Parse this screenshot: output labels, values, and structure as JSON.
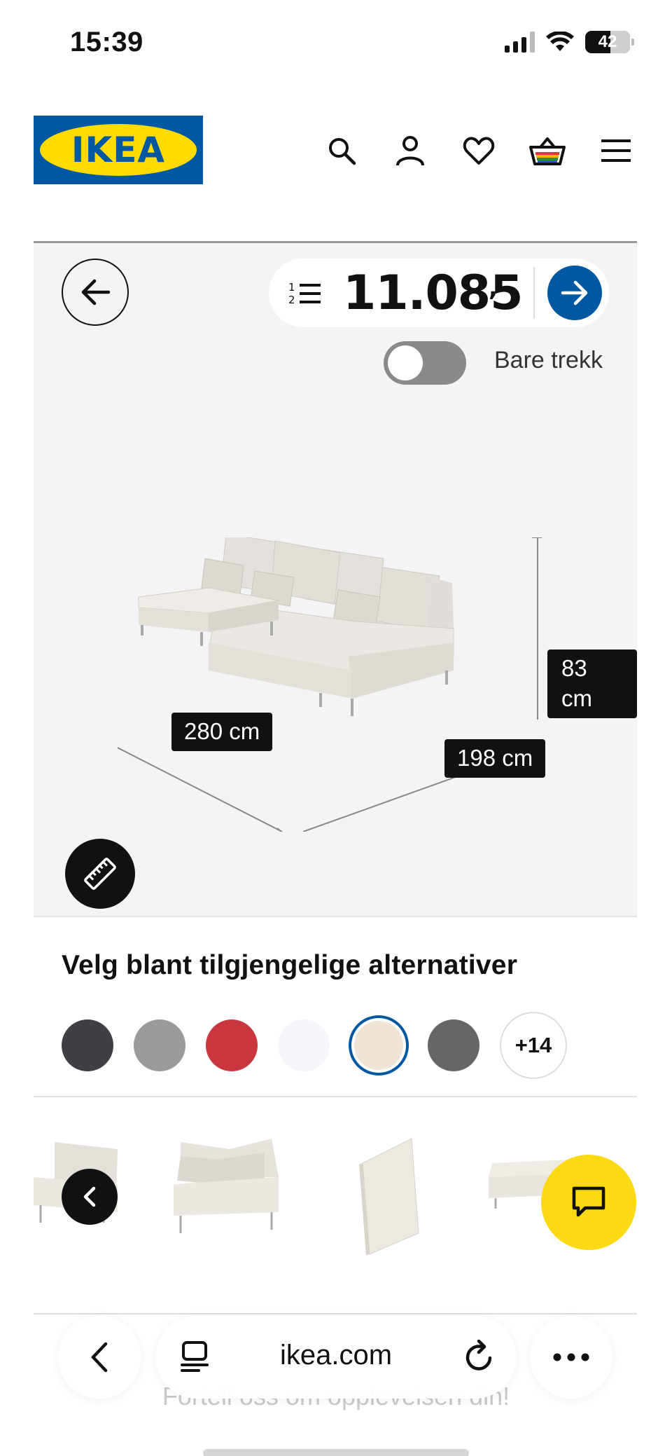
{
  "status_bar": {
    "time": "15:39",
    "battery": "42",
    "icons": [
      "signal-icon",
      "wifi-icon",
      "battery-icon"
    ]
  },
  "header": {
    "logo_text": "IKEA",
    "icons": [
      "search-icon",
      "account-icon",
      "heart-icon",
      "basket-icon",
      "menu-icon"
    ]
  },
  "viewer": {
    "price": "11.085",
    "price_suffix": ",-",
    "toggle_label": "Bare trekk",
    "toggle_on": false,
    "dimensions": {
      "width": "280 cm",
      "depth": "198 cm",
      "height_line1": "83",
      "height_line2": "cm"
    }
  },
  "alternatives": {
    "title": "Velg blant tilgjengelige alternativer",
    "swatches": [
      {
        "color": "#3f3f44",
        "selected": false
      },
      {
        "color": "#9a9a9a",
        "selected": false
      },
      {
        "color": "#c9363e",
        "selected": false
      },
      {
        "color": "#f4f6fa",
        "selected": false
      },
      {
        "color": "#efe4d5",
        "selected": true
      },
      {
        "color": "#666666",
        "selected": false
      }
    ],
    "more_label": "+14"
  },
  "browser": {
    "url": "ikea.com"
  },
  "feedback_text": "Fortell oss om opplevelsen din!",
  "colors": {
    "ikea_blue": "#0058a3",
    "ikea_yellow": "#ffdb00",
    "chat_yellow": "#fbd914"
  }
}
